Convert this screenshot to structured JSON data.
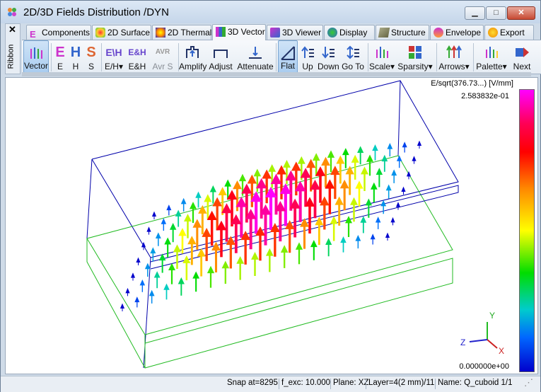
{
  "window": {
    "title": "2D/3D Fields Distribution /DYN"
  },
  "side_panel": {
    "close": "✕",
    "label": "Ribbon"
  },
  "tabs": [
    {
      "label": "Components",
      "icon": "components-icon"
    },
    {
      "label": "2D Surface",
      "icon": "surface-icon"
    },
    {
      "label": "2D Thermal",
      "icon": "thermal-icon"
    },
    {
      "label": "3D Vector",
      "icon": "vector-icon",
      "active": true
    },
    {
      "label": "3D Viewer",
      "icon": "viewer-icon"
    },
    {
      "label": "Display",
      "icon": "display-icon"
    },
    {
      "label": "Structure",
      "icon": "structure-icon"
    },
    {
      "label": "Envelope",
      "icon": "envelope-icon"
    },
    {
      "label": "Export",
      "icon": "export-icon"
    }
  ],
  "ribbon": {
    "vector": "Vector",
    "e": "E",
    "h": "H",
    "s": "S",
    "eh_menu": "E/H",
    "eh": "E&H",
    "avr_s": "Avr S",
    "amplify": "Amplify",
    "adjust": "Adjust",
    "attenuate": "Attenuate",
    "flat": "Flat",
    "up": "Up",
    "down": "Down",
    "goto": "Go To",
    "scale": "Scale",
    "sparsity": "Sparsity",
    "arrows": "Arrows",
    "palette": "Palette",
    "next": "Next",
    "icon_e": "E",
    "icon_h": "H",
    "icon_s": "S",
    "icon_eh": "E\\H",
    "icon_ehand": "E&H",
    "icon_avr": "AVR"
  },
  "legend": {
    "title": "E/sqrt(376.73...) [V/mm]",
    "max": "2.583832e-01",
    "min": "0.000000e+00"
  },
  "axes": {
    "y": "Y",
    "z": "Z",
    "x": "X"
  },
  "status": {
    "snap": "Snap at=8295",
    "fexc": "f_exc: 10.000",
    "plane": "Plane: XZ",
    "layer": "Layer=4(2 mm)/11",
    "name": "Name: Q_cuboid 1/1"
  },
  "colors": {
    "accent": "#7aa6d2",
    "box_outline": "#0000aa",
    "plane_outline": "#22bb22"
  }
}
